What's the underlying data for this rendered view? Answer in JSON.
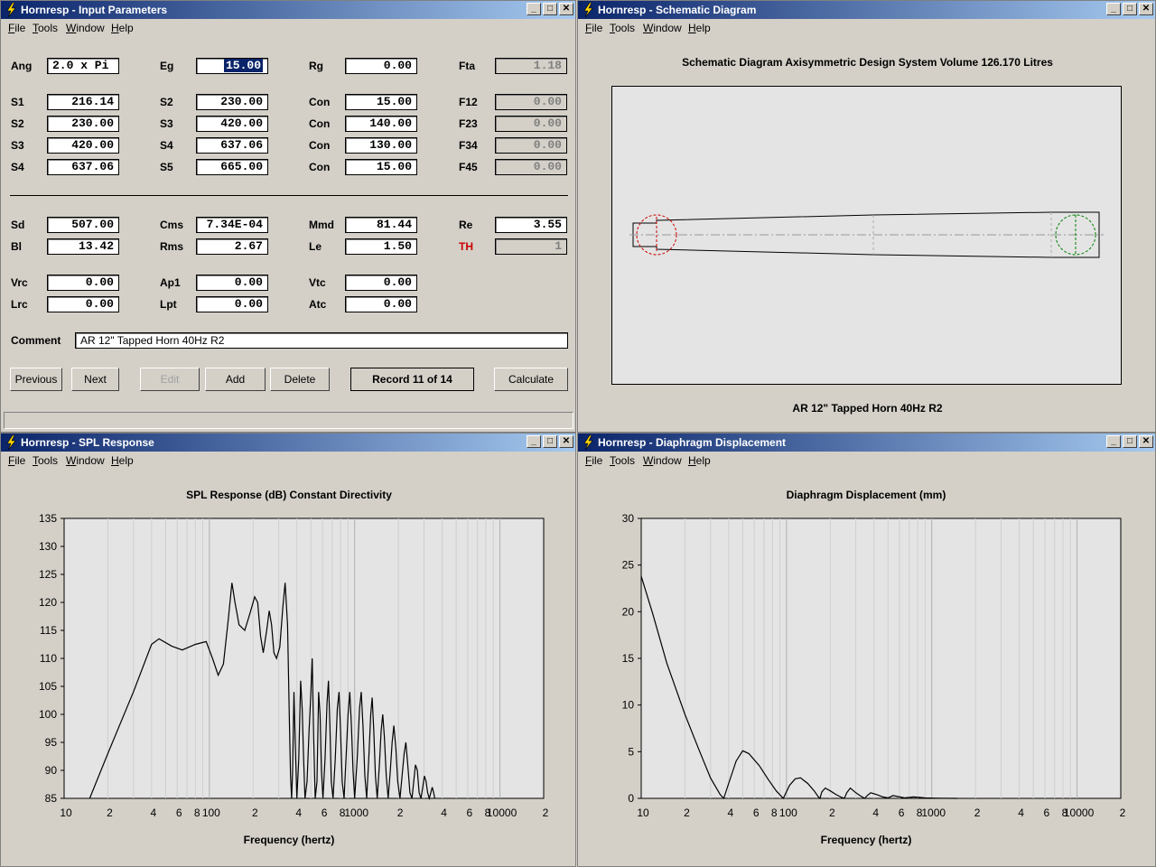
{
  "menus": [
    "File",
    "Tools",
    "Window",
    "Help"
  ],
  "input_window": {
    "title": "Hornresp - Input Parameters",
    "rows": [
      [
        {
          "l": "Ang",
          "v": "2.0 x Pi",
          "mode": "left"
        },
        {
          "l": "Eg",
          "v": "15.00",
          "mode": "sel"
        },
        {
          "l": "Rg",
          "v": "0.00"
        },
        {
          "l": "Fta",
          "v": "1.18",
          "mode": "gray"
        }
      ],
      [
        {
          "l": "S1",
          "v": "216.14"
        },
        {
          "l": "S2",
          "v": "230.00"
        },
        {
          "l": "Con",
          "v": "15.00"
        },
        {
          "l": "F12",
          "v": "0.00",
          "mode": "gray"
        }
      ],
      [
        {
          "l": "S2",
          "v": "230.00"
        },
        {
          "l": "S3",
          "v": "420.00"
        },
        {
          "l": "Con",
          "v": "140.00"
        },
        {
          "l": "F23",
          "v": "0.00",
          "mode": "gray"
        }
      ],
      [
        {
          "l": "S3",
          "v": "420.00"
        },
        {
          "l": "S4",
          "v": "637.06"
        },
        {
          "l": "Con",
          "v": "130.00"
        },
        {
          "l": "F34",
          "v": "0.00",
          "mode": "gray"
        }
      ],
      [
        {
          "l": "S4",
          "v": "637.06"
        },
        {
          "l": "S5",
          "v": "665.00"
        },
        {
          "l": "Con",
          "v": "15.00"
        },
        {
          "l": "F45",
          "v": "0.00",
          "mode": "gray"
        }
      ],
      [
        {
          "l": "Sd",
          "v": "507.00"
        },
        {
          "l": "Cms",
          "v": "7.34E-04"
        },
        {
          "l": "Mmd",
          "v": "81.44"
        },
        {
          "l": "Re",
          "v": "3.55"
        }
      ],
      [
        {
          "l": "Bl",
          "v": "13.42"
        },
        {
          "l": "Rms",
          "v": "2.67"
        },
        {
          "l": "Le",
          "v": "1.50"
        },
        {
          "l": "TH",
          "v": "1",
          "mode": "gray",
          "red": true
        }
      ],
      [
        {
          "l": "Vrc",
          "v": "0.00"
        },
        {
          "l": "Ap1",
          "v": "0.00"
        },
        {
          "l": "Vtc",
          "v": "0.00"
        }
      ],
      [
        {
          "l": "Lrc",
          "v": "0.00"
        },
        {
          "l": "Lpt",
          "v": "0.00"
        },
        {
          "l": "Atc",
          "v": "0.00"
        }
      ]
    ],
    "comment_label": "Comment",
    "comment_value": "AR 12\" Tapped Horn 40Hz R2",
    "buttons": {
      "previous": "Previous",
      "next": "Next",
      "edit": "Edit",
      "add": "Add",
      "delete": "Delete",
      "record": "Record 11 of 14",
      "calculate": "Calculate"
    }
  },
  "schematic_window": {
    "title": "Hornresp - Schematic Diagram",
    "header": "Schematic Diagram   Axisymmetric Design   System Volume 126.170 Litres",
    "caption": "AR 12\" Tapped Horn 40Hz R2"
  },
  "spl_window": {
    "title": "Hornresp - SPL Response",
    "chart_title": "SPL Response (dB)   Constant Directivity",
    "xlabel": "Frequency (hertz)"
  },
  "disp_window": {
    "title": "Hornresp - Diaphragm Displacement",
    "chart_title": "Diaphragm Displacement (mm)",
    "xlabel": "Frequency (hertz)"
  },
  "colors": {
    "title_start": "#0a246a",
    "title_end": "#a6caf0",
    "plot_bg": "#e4e4e4",
    "input_circle": "#cc0000",
    "output_circle": "#008000",
    "th_label": "#cc0000"
  },
  "chart_data": [
    {
      "type": "line",
      "title": "SPL Response (dB)   Constant Directivity",
      "xlabel": "Frequency (hertz)",
      "ylabel": "",
      "xscale": "log",
      "xlim": [
        10,
        20000
      ],
      "ylim": [
        85,
        135
      ],
      "yticks": [
        85,
        90,
        95,
        100,
        105,
        110,
        115,
        120,
        125,
        130,
        135
      ],
      "xtick_labels": [
        "10",
        "2",
        "4",
        "6",
        "8",
        "100",
        "2",
        "4",
        "6",
        "8",
        "1000",
        "2",
        "4",
        "6",
        "8",
        "10000",
        "2"
      ],
      "grid": true,
      "series": [
        {
          "points": [
            [
              15,
              85
            ],
            [
              20,
              93
            ],
            [
              30,
              104
            ],
            [
              40,
              112.5
            ],
            [
              45,
              113.5
            ],
            [
              55,
              112.2
            ],
            [
              65,
              111.5
            ],
            [
              80,
              112.5
            ],
            [
              95,
              113
            ],
            [
              105,
              110
            ],
            [
              115,
              107
            ],
            [
              125,
              109
            ],
            [
              135,
              117
            ],
            [
              143,
              123.5
            ],
            [
              150,
              120
            ],
            [
              160,
              116
            ],
            [
              175,
              115
            ],
            [
              190,
              118
            ],
            [
              205,
              121
            ],
            [
              215,
              120
            ],
            [
              225,
              114
            ],
            [
              235,
              111
            ],
            [
              248,
              115
            ],
            [
              258,
              118.5
            ],
            [
              268,
              116
            ],
            [
              278,
              111
            ],
            [
              290,
              110
            ],
            [
              305,
              112
            ],
            [
              320,
              119
            ],
            [
              332,
              123.5
            ],
            [
              345,
              116
            ],
            [
              355,
              99
            ],
            [
              362,
              89
            ],
            [
              368,
              85
            ],
            [
              374,
              90
            ],
            [
              382,
              104
            ],
            [
              390,
              95
            ],
            [
              400,
              85
            ],
            [
              412,
              92
            ],
            [
              425,
              106
            ],
            [
              435,
              101
            ],
            [
              445,
              92
            ],
            [
              455,
              85
            ],
            [
              470,
              88
            ],
            [
              485,
              97
            ],
            [
              498,
              103
            ],
            [
              510,
              110
            ],
            [
              522,
              96
            ],
            [
              535,
              85
            ],
            [
              550,
              88
            ],
            [
              565,
              104
            ],
            [
              578,
              100
            ],
            [
              590,
              90
            ],
            [
              605,
              85
            ],
            [
              625,
              92
            ],
            [
              645,
              102
            ],
            [
              660,
              106
            ],
            [
              675,
              98
            ],
            [
              690,
              88
            ],
            [
              710,
              85
            ],
            [
              735,
              92
            ],
            [
              760,
              101
            ],
            [
              780,
              104
            ],
            [
              800,
              97
            ],
            [
              820,
              88
            ],
            [
              845,
              85
            ],
            [
              875,
              93
            ],
            [
              900,
              100
            ],
            [
              925,
              104
            ],
            [
              950,
              98
            ],
            [
              975,
              90
            ],
            [
              1000,
              85
            ],
            [
              1040,
              92
            ],
            [
              1080,
              101
            ],
            [
              1110,
              104
            ],
            [
              1140,
              98
            ],
            [
              1175,
              89
            ],
            [
              1210,
              85
            ],
            [
              1250,
              92
            ],
            [
              1290,
              100
            ],
            [
              1320,
              103
            ],
            [
              1355,
              97
            ],
            [
              1390,
              89
            ],
            [
              1430,
              85
            ],
            [
              1480,
              91
            ],
            [
              1520,
              97
            ],
            [
              1560,
              100
            ],
            [
              1600,
              96
            ],
            [
              1650,
              89
            ],
            [
              1700,
              85
            ],
            [
              1760,
              90
            ],
            [
              1810,
              95
            ],
            [
              1860,
              98
            ],
            [
              1920,
              94
            ],
            [
              1980,
              88
            ],
            [
              2050,
              85
            ],
            [
              2120,
              89
            ],
            [
              2190,
              93
            ],
            [
              2250,
              95
            ],
            [
              2320,
              91
            ],
            [
              2400,
              86
            ],
            [
              2480,
              85
            ],
            [
              2550,
              88
            ],
            [
              2620,
              91
            ],
            [
              2700,
              90
            ],
            [
              2780,
              86
            ],
            [
              2860,
              85
            ],
            [
              2940,
              87
            ],
            [
              3020,
              89
            ],
            [
              3100,
              88
            ],
            [
              3180,
              86
            ],
            [
              3260,
              85
            ],
            [
              3340,
              86
            ],
            [
              3420,
              87
            ],
            [
              3500,
              86
            ],
            [
              3560,
              85
            ]
          ]
        }
      ]
    },
    {
      "type": "line",
      "title": "Diaphragm Displacement (mm)",
      "xlabel": "Frequency (hertz)",
      "ylabel": "",
      "xscale": "log",
      "xlim": [
        10,
        20000
      ],
      "ylim": [
        0,
        30
      ],
      "yticks": [
        0,
        5,
        10,
        15,
        20,
        25,
        30
      ],
      "xtick_labels": [
        "10",
        "2",
        "4",
        "6",
        "8",
        "100",
        "2",
        "4",
        "6",
        "8",
        "1000",
        "2",
        "4",
        "6",
        "8",
        "10000",
        "2"
      ],
      "grid": true,
      "series": [
        {
          "points": [
            [
              10,
              23.8
            ],
            [
              12,
              19.8
            ],
            [
              15,
              14.5
            ],
            [
              20,
              9
            ],
            [
              25,
              5.2
            ],
            [
              30,
              2.2
            ],
            [
              35,
              0.4
            ],
            [
              37,
              0
            ],
            [
              40,
              1.6
            ],
            [
              45,
              4
            ],
            [
              50,
              5.1
            ],
            [
              55,
              4.8
            ],
            [
              65,
              3.5
            ],
            [
              75,
              2
            ],
            [
              85,
              0.8
            ],
            [
              95,
              0
            ],
            [
              105,
              1.4
            ],
            [
              115,
              2.1
            ],
            [
              125,
              2.2
            ],
            [
              140,
              1.6
            ],
            [
              155,
              0.8
            ],
            [
              165,
              0.2
            ],
            [
              170,
              0
            ],
            [
              175,
              0.7
            ],
            [
              185,
              1.1
            ],
            [
              200,
              0.8
            ],
            [
              220,
              0.4
            ],
            [
              240,
              0.1
            ],
            [
              250,
              0
            ],
            [
              260,
              0.6
            ],
            [
              275,
              1.1
            ],
            [
              295,
              0.7
            ],
            [
              320,
              0.3
            ],
            [
              345,
              0
            ],
            [
              360,
              0.3
            ],
            [
              380,
              0.6
            ],
            [
              420,
              0.4
            ],
            [
              460,
              0.15
            ],
            [
              500,
              0.05
            ],
            [
              540,
              0.3
            ],
            [
              580,
              0.2
            ],
            [
              650,
              0.05
            ],
            [
              750,
              0.15
            ],
            [
              900,
              0.05
            ],
            [
              1100,
              0.02
            ],
            [
              1500,
              0
            ]
          ]
        }
      ]
    }
  ]
}
